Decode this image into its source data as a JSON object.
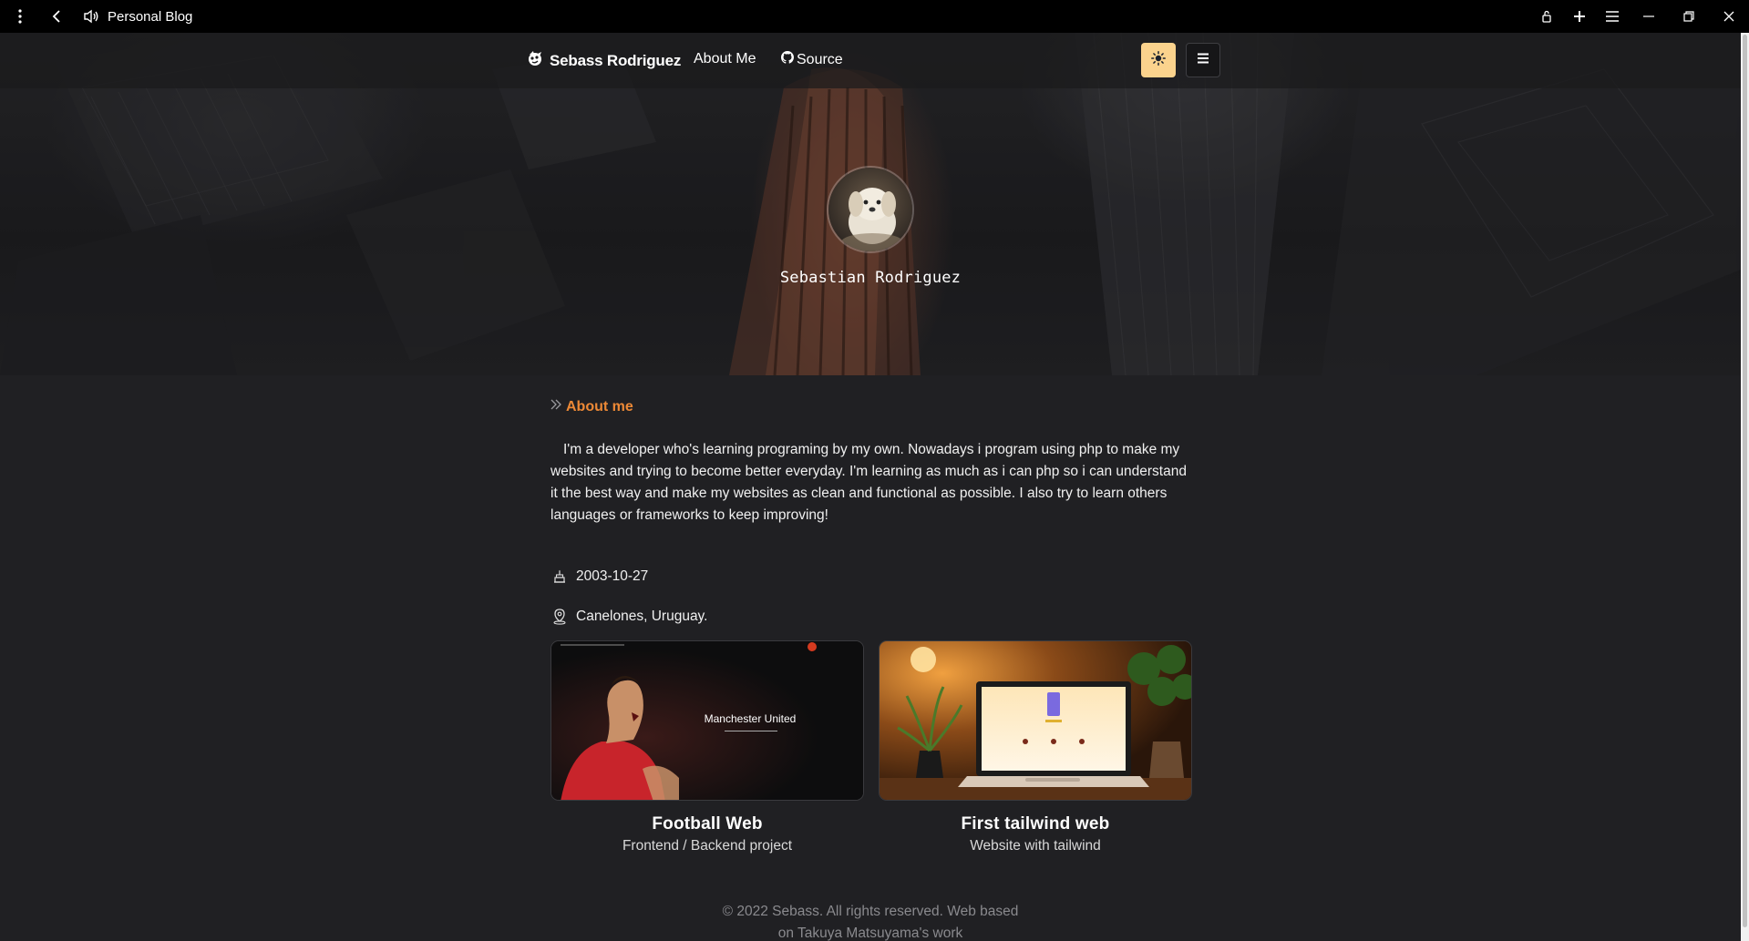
{
  "window": {
    "title": "Personal Blog",
    "icons": [
      "kebab-menu-icon",
      "back-arrow-icon",
      "speaker-icon",
      "lock-icon",
      "plus-icon",
      "hamburger-icon",
      "minimize-icon",
      "restore-icon",
      "close-icon"
    ]
  },
  "navbar": {
    "brand": "Sebass Rodriguez",
    "links": [
      "About Me",
      "Source"
    ],
    "theme_toggle_icon": "sun-icon",
    "menu_icon": "hamburger-icon"
  },
  "profile": {
    "name": "Sebastian Rodriguez"
  },
  "about": {
    "heading": "About me",
    "bio": "I'm a developer who's learning programing by my own. Nowadays i program using php to make my websites and trying to become better everyday. I'm learning as much as i can php so i can understand it the best way and make my websites as clean and functional as possible. I also try to learn others languages or frameworks to keep improving!",
    "birthday": "2003-10-27",
    "location": "Canelones, Uruguay."
  },
  "projects": [
    {
      "title": "Football Web",
      "subtitle": "Frontend / Backend project",
      "thumb_caption": "Manchester United"
    },
    {
      "title": "First tailwind web",
      "subtitle": "Website with tailwind"
    }
  ],
  "footer": {
    "text": "© 2022 Sebass. All rights reserved. Web based on Takuya Matsuyama's work"
  },
  "colors": {
    "accent": "#ed8936",
    "theme_button": "#fbd38d",
    "background": "#202023"
  }
}
